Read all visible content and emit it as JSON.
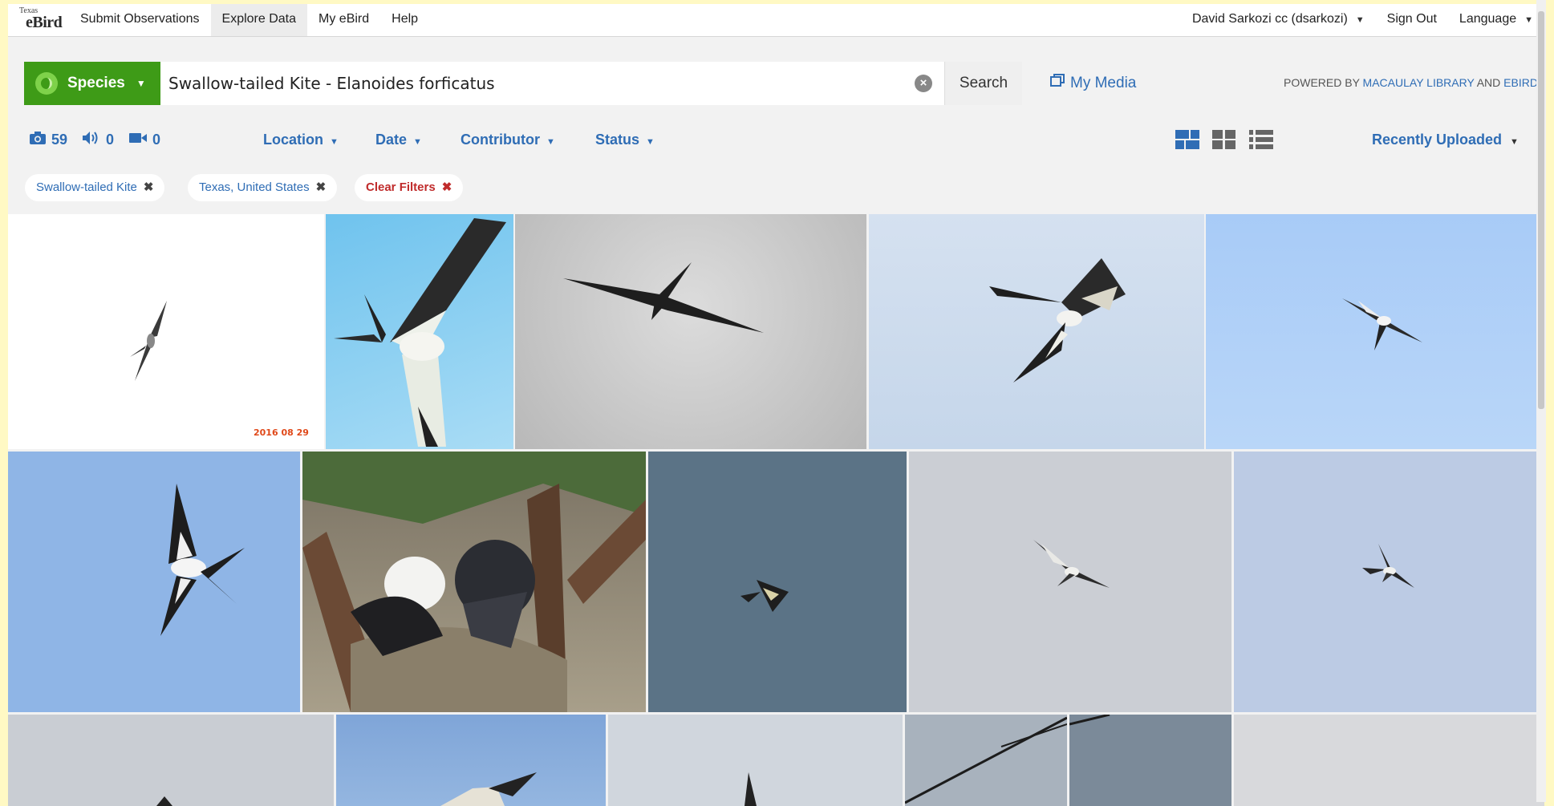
{
  "topnav": {
    "logo_small": "Texas",
    "logo_main": "eBird",
    "items": [
      {
        "label": "Submit Observations"
      },
      {
        "label": "Explore Data",
        "active": true
      },
      {
        "label": "My eBird"
      },
      {
        "label": "Help"
      }
    ],
    "user": "David Sarkozi cc (dsarkozi)",
    "sign_out": "Sign Out",
    "language": "Language"
  },
  "search": {
    "mode_label": "Species",
    "query": "Swallow-tailed Kite - Elanoides forficatus",
    "button": "Search",
    "my_media": "My Media",
    "powered_prefix": "POWERED BY ",
    "powered_1": "MACAULAY LIBRARY",
    "powered_and": " AND ",
    "powered_2": "EBIRD"
  },
  "counts": {
    "photos": "59",
    "audio": "0",
    "video": "0",
    "icons": [
      "camera-icon",
      "speaker-icon",
      "video-icon"
    ]
  },
  "filters": {
    "location": "Location",
    "date": "Date",
    "contributor": "Contributor",
    "status": "Status"
  },
  "sort": "Recently Uploaded",
  "chips": {
    "species": "Swallow-tailed Kite",
    "region": "Texas, United States",
    "clear": "Clear Filters",
    "remove_glyph": "✖"
  },
  "photos": {
    "stamp_text": "2016 08 29"
  },
  "colors": {
    "accent": "#2f6db5",
    "species_button": "#3e9b17",
    "clear_filters": "#c02b2b"
  }
}
